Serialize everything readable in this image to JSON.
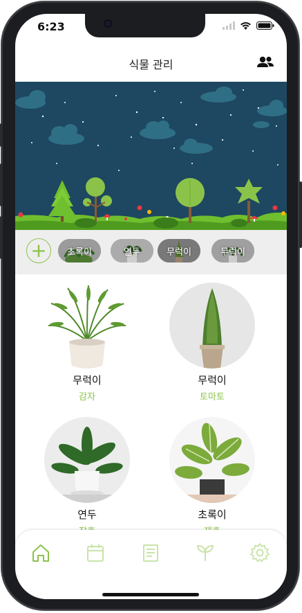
{
  "status": {
    "time": "6:23"
  },
  "header": {
    "title": "식물 관리"
  },
  "chips": [
    {
      "label": "초록이"
    },
    {
      "label": "연두"
    },
    {
      "label": "무럭이"
    },
    {
      "label": "무럭이"
    }
  ],
  "add_button": {
    "label": "+"
  },
  "plants": [
    {
      "name": "무럭이",
      "sub": "감자"
    },
    {
      "name": "무럭이",
      "sub": "토마토"
    },
    {
      "name": "연두",
      "sub": "장호"
    },
    {
      "name": "초록이",
      "sub": "재호"
    }
  ],
  "tabs": [
    {
      "icon": "home-icon",
      "active": true
    },
    {
      "icon": "calendar-icon",
      "active": false
    },
    {
      "icon": "journal-icon",
      "active": false
    },
    {
      "icon": "sprout-icon",
      "active": false
    },
    {
      "icon": "settings-gear-icon",
      "active": false
    }
  ],
  "colors": {
    "accent": "#8bc34a",
    "banner_sky": "#1e4761",
    "grass": "#6fbf2e"
  }
}
